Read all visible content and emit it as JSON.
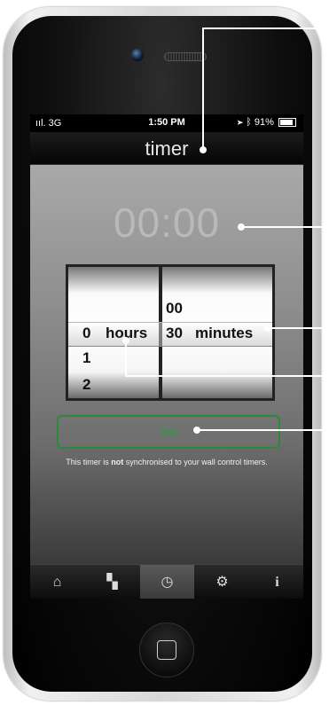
{
  "status": {
    "signal": "ııl. 3G",
    "time": "1:50 PM",
    "battery": "91%"
  },
  "title": "timer",
  "timer_display": "00:00",
  "picker": {
    "hours": {
      "above": "",
      "selected": "0",
      "below": [
        "1",
        "2"
      ],
      "unit": "hours"
    },
    "minutes": {
      "above": "00",
      "selected": "30",
      "unit": "minutes"
    }
  },
  "set_label": "Set",
  "note": {
    "pre": "This timer is ",
    "bold": "not",
    "post": " synchronised to your wall control timers."
  },
  "tabs": [
    {
      "icon": "home-icon",
      "glyph": "⌂"
    },
    {
      "icon": "grid-icon",
      "glyph": "▚"
    },
    {
      "icon": "timer-icon",
      "glyph": "◷"
    },
    {
      "icon": "settings-icon",
      "glyph": "⚙"
    },
    {
      "icon": "info-icon",
      "glyph": "i"
    }
  ],
  "active_tab": 2
}
